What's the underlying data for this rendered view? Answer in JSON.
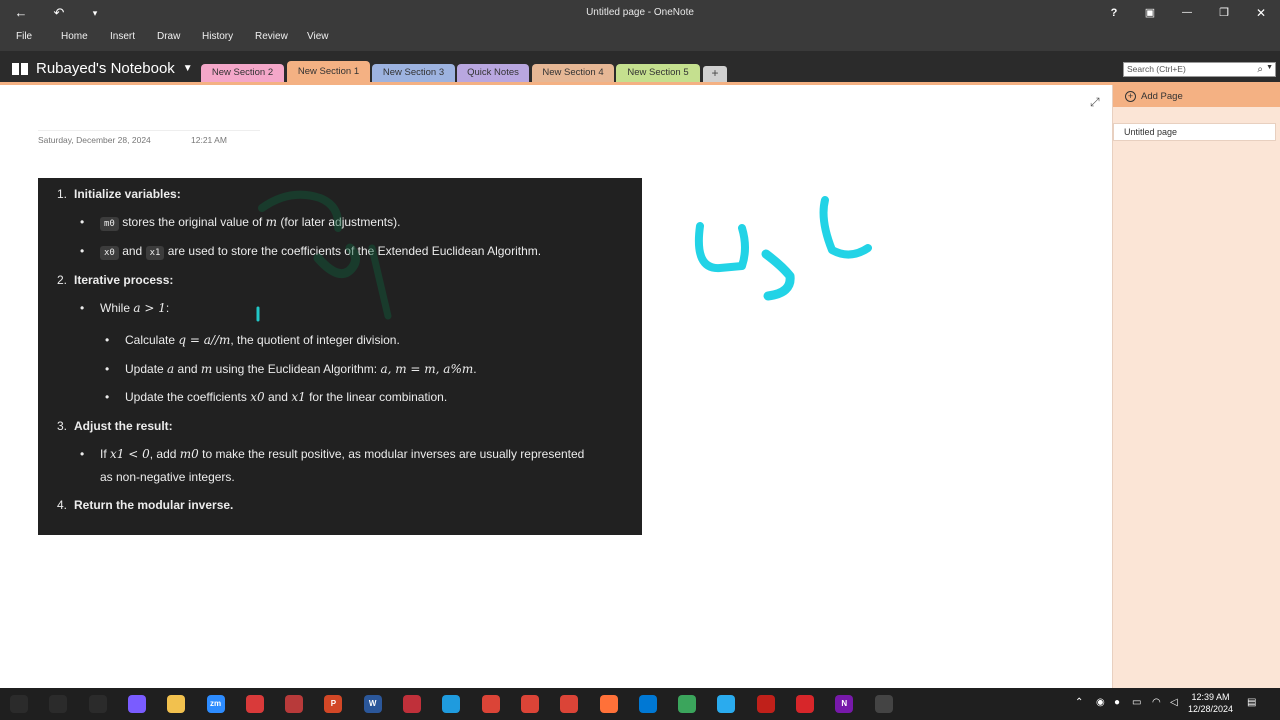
{
  "window": {
    "title": "Untitled page - OneNote",
    "help": "?",
    "restore_ribbon": "▣",
    "minimize": "—",
    "maximize": "❐",
    "close": "✕",
    "back": "←",
    "undo": "↶",
    "qat": "▾"
  },
  "ribbon": {
    "tabs": [
      "File",
      "Home",
      "Insert",
      "Draw",
      "History",
      "Review",
      "View"
    ]
  },
  "notebook": {
    "name": "Rubayed's Notebook",
    "sections": [
      {
        "label": "New Section 2",
        "color": "#f4a7c9"
      },
      {
        "label": "New Section 1",
        "color": "#f4b183"
      },
      {
        "label": "New Section 3",
        "color": "#9db3e0"
      },
      {
        "label": "Quick Notes",
        "color": "#b9a7e0"
      },
      {
        "label": "New Section 4",
        "color": "#e6b795"
      },
      {
        "label": "New Section 5",
        "color": "#c5e08f"
      }
    ],
    "add_section": "+",
    "search_placeholder": "Search (Ctrl+E)"
  },
  "page": {
    "date": "Saturday, December 28, 2024",
    "time": "12:21 AM",
    "content": {
      "l1_num": "1.",
      "l1_text": "Initialize variables:",
      "l2_code": "m0",
      "l2_text": "stores the original value of",
      "l2_var": "m",
      "l2_tail": "(for later adjustments).",
      "l3_code1": "x0",
      "l3_and": "and",
      "l3_code2": "x1",
      "l3_text": "are used to store the coefficients of the Extended Euclidean Algorithm.",
      "l4_num": "2.",
      "l4_text": "Iterative process:",
      "l5_text": "While",
      "l5_math": "a > 1",
      "l6_text": "Calculate",
      "l6_math": "q = a//m",
      "l6_tail": ", the quotient of integer division.",
      "l7_text": "Update",
      "l7_a": "a",
      "l7_and": "and",
      "l7_m": "m",
      "l7_mid": "using the Euclidean Algorithm:",
      "l7_math": "a, m = m, a%m",
      "l8_text": "Update the coefficients",
      "l8_x0": "x0",
      "l8_and": "and",
      "l8_x1": "x1",
      "l8_tail": "for the linear combination.",
      "l9_num": "3.",
      "l9_text": "Adjust the result:",
      "l10_if": "If",
      "l10_math": "x1 < 0",
      "l10_add": ", add",
      "l10_m0": "m0",
      "l10_tail": "to make the result positive, as modular inverses are usually represented",
      "l11_text": "as non-negative integers.",
      "l12_num": "4.",
      "l12_text": "Return the modular inverse."
    }
  },
  "pages_panel": {
    "add_page": "Add Page",
    "pages": [
      "Untitled page"
    ]
  },
  "taskbar": {
    "apps": [
      {
        "label": "",
        "color": "#2b2b2b"
      },
      {
        "label": "",
        "color": "#2b2b2b"
      },
      {
        "label": "",
        "color": "#2b2b2b"
      },
      {
        "label": "",
        "color": "#7a5cff"
      },
      {
        "label": "",
        "color": "#f2c14e"
      },
      {
        "label": "zm",
        "color": "#2d8cff"
      },
      {
        "label": "",
        "color": "#d93a3a"
      },
      {
        "label": "",
        "color": "#b83a3a"
      },
      {
        "label": "P",
        "color": "#d24726"
      },
      {
        "label": "W",
        "color": "#2b579a"
      },
      {
        "label": "",
        "color": "#c0303a"
      },
      {
        "label": "",
        "color": "#1f9bde"
      },
      {
        "label": "",
        "color": "#db4437"
      },
      {
        "label": "",
        "color": "#db4437"
      },
      {
        "label": "",
        "color": "#db4437"
      },
      {
        "label": "",
        "color": "#ff7139"
      },
      {
        "label": "",
        "color": "#0078d4"
      },
      {
        "label": "",
        "color": "#3ba55c"
      },
      {
        "label": "",
        "color": "#2aabee"
      },
      {
        "label": "",
        "color": "#c0201a"
      },
      {
        "label": "",
        "color": "#d7262a"
      },
      {
        "label": "N",
        "color": "#7719aa"
      },
      {
        "label": "",
        "color": "#444444"
      }
    ],
    "time": "12:39 AM",
    "date": "12/28/2024"
  }
}
